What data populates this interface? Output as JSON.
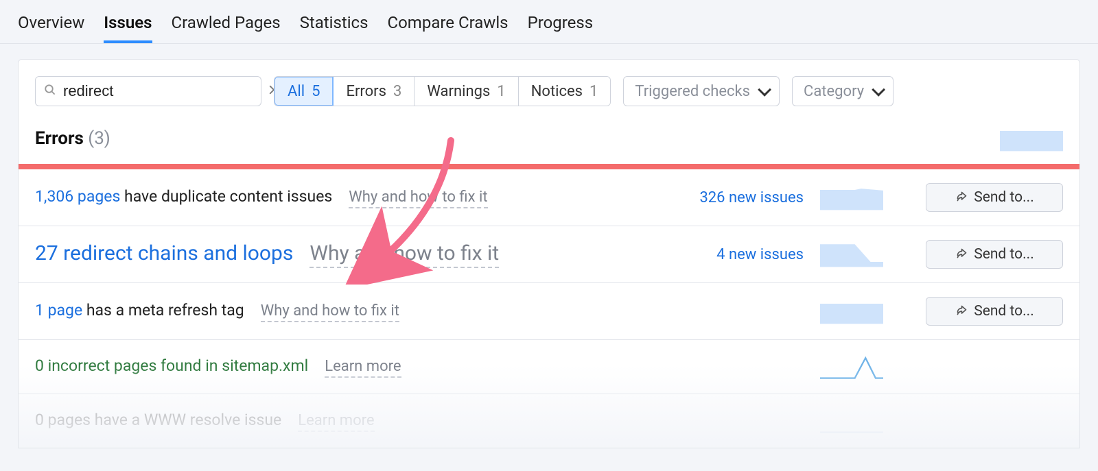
{
  "tabs": {
    "overview": "Overview",
    "issues": "Issues",
    "crawled": "Crawled Pages",
    "statistics": "Statistics",
    "compare": "Compare Crawls",
    "progress": "Progress"
  },
  "search": {
    "value": "redirect"
  },
  "segments": {
    "all": {
      "label": "All",
      "count": "5"
    },
    "errors": {
      "label": "Errors",
      "count": "3"
    },
    "warnings": {
      "label": "Warnings",
      "count": "1"
    },
    "notices": {
      "label": "Notices",
      "count": "1"
    }
  },
  "dropdowns": {
    "triggered": "Triggered checks",
    "category": "Category"
  },
  "cat": {
    "label": "Errors",
    "count": "(3)"
  },
  "buttons": {
    "sendto": "Send to..."
  },
  "rows": {
    "r1": {
      "link": "1,306 pages",
      "rest": " have duplicate content issues",
      "why": "Why and how to fix it",
      "new": "326 new issues"
    },
    "r2": {
      "text": "27 redirect chains and loops",
      "why": "Why and how to fix it",
      "new": "4 new issues"
    },
    "r3": {
      "link": "1 page",
      "rest": " has a meta refresh tag",
      "why": "Why and how to fix it",
      "new": ""
    },
    "r4": {
      "text": "0 incorrect pages found in sitemap.xml",
      "why": "Learn more"
    },
    "r5": {
      "text": "0 pages have a WWW resolve issue",
      "why": "Learn more"
    }
  }
}
